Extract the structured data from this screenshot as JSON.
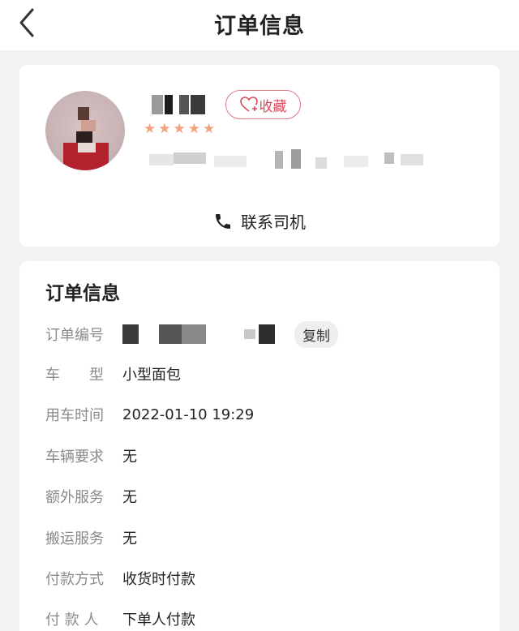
{
  "header": {
    "title": "订单信息"
  },
  "driver": {
    "collect_label": "收藏",
    "rating_stars": 5,
    "contact_label": "联系司机"
  },
  "order": {
    "section_title": "订单信息",
    "copy_label": "复制",
    "rows": [
      {
        "label": "订单编号",
        "value": ""
      },
      {
        "label": "车　　型",
        "value": "小型面包"
      },
      {
        "label": "用车时间",
        "value": "2022-01-10 19:29"
      },
      {
        "label": "车辆要求",
        "value": "无"
      },
      {
        "label": "额外服务",
        "value": "无"
      },
      {
        "label": "搬运服务",
        "value": "无"
      },
      {
        "label": "付款方式",
        "value": "收货时付款"
      },
      {
        "label": "付 款 人",
        "value": "下单人付款"
      }
    ]
  },
  "colors": {
    "accent": "#d94a5a",
    "star": "#f3a27f"
  }
}
